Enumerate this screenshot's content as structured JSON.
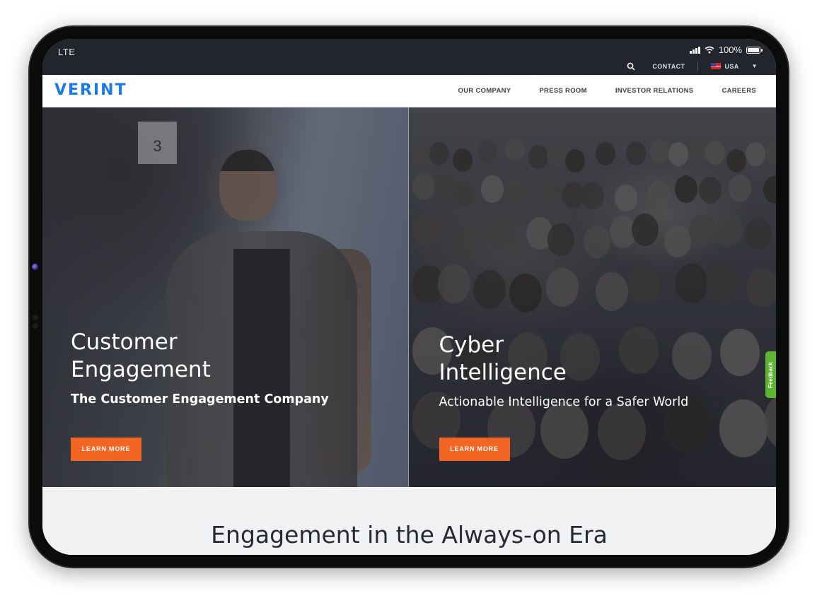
{
  "status_bar": {
    "carrier": "LTE",
    "battery": "100%",
    "battery_level": 1.0
  },
  "utility_bar": {
    "search_icon": "search-icon",
    "contact_label": "CONTACT",
    "region_label": "USA",
    "region_flag": "us-flag-icon"
  },
  "nav": {
    "logo": "VERINT",
    "links": [
      {
        "label": "OUR COMPANY"
      },
      {
        "label": "PRESS ROOM"
      },
      {
        "label": "INVESTOR RELATIONS"
      },
      {
        "label": "CAREERS"
      }
    ]
  },
  "hero": {
    "left": {
      "title_line1": "Customer",
      "title_line2": "Engagement",
      "subtitle": "The Customer Engagement Company",
      "button": "LEARN MORE",
      "sign_number": "3"
    },
    "right": {
      "title_line1": "Cyber",
      "title_line2": "Intelligence",
      "subtitle": "Actionable Intelligence for a Safer World",
      "button": "LEARN MORE"
    }
  },
  "feedback_tab": "Feedback",
  "section": {
    "title": "Engagement in the Always-on Era"
  },
  "colors": {
    "brand_blue": "#1a7ae8",
    "cta_orange": "#f26522",
    "feedback_green": "#5cb531",
    "status_bar_bg": "#22252b"
  }
}
